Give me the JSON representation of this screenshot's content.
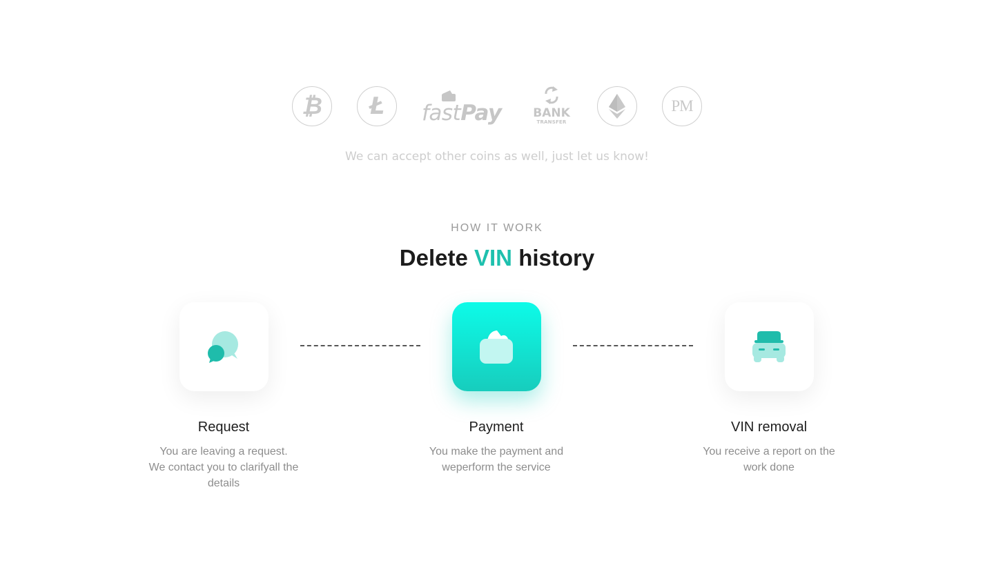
{
  "payment_methods": [
    {
      "name": "bitcoin",
      "symbol": "₿"
    },
    {
      "name": "litecoin",
      "symbol": "Ł"
    },
    {
      "name": "fastpay",
      "label_light": "fast",
      "label_bold": "Pay"
    },
    {
      "name": "bank-transfer",
      "label": "BANK",
      "sublabel": "TRANSFER"
    },
    {
      "name": "ethereum"
    },
    {
      "name": "perfect-money",
      "label": "PM"
    }
  ],
  "note": "We can accept other coins as well, just let us know!",
  "how_it_works": {
    "eyebrow": "HOW IT WORK",
    "title_prefix": "Delete",
    "title_accent": "VIN",
    "title_suffix": "history",
    "steps": [
      {
        "title": "Request",
        "description": "You are leaving a request.\nWe contact you to clarifyall the\ndetails"
      },
      {
        "title": "Payment",
        "description": "You make the payment and\nweperform the service"
      },
      {
        "title": "VIN removal",
        "description": "You receive a report on the\nwork done"
      }
    ]
  },
  "colors": {
    "accent": "#1ec0ae",
    "accent_bright": "#0dfbe8",
    "muted": "#cfcfcf",
    "text": "#1c1c1c"
  }
}
